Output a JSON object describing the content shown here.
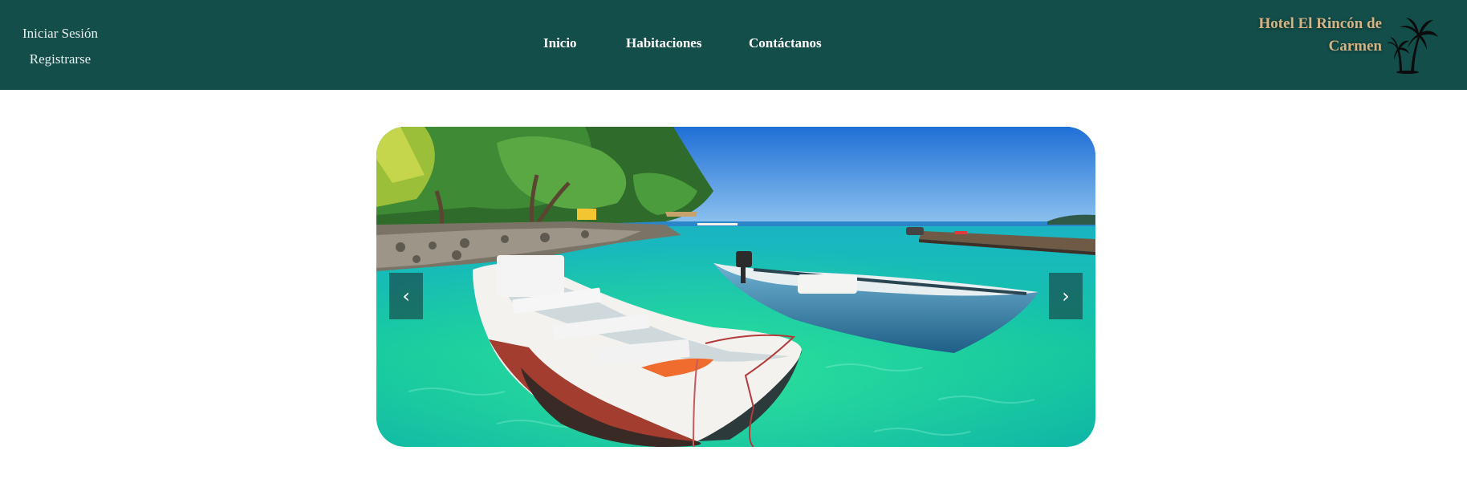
{
  "header": {
    "auth_links": [
      "Iniciar Sesión",
      "Registrarse"
    ],
    "nav": [
      "Inicio",
      "Habitaciones",
      "Contáctanos"
    ],
    "brand": "Hotel El Rincón de Carmen",
    "logo_icon": "palm-trees-icon",
    "background": "#134e4a",
    "brand_color": "#d4b486"
  },
  "carousel": {
    "prev_icon": "‹",
    "next_icon": "›",
    "scene": "two-boats-turquoise-water"
  }
}
